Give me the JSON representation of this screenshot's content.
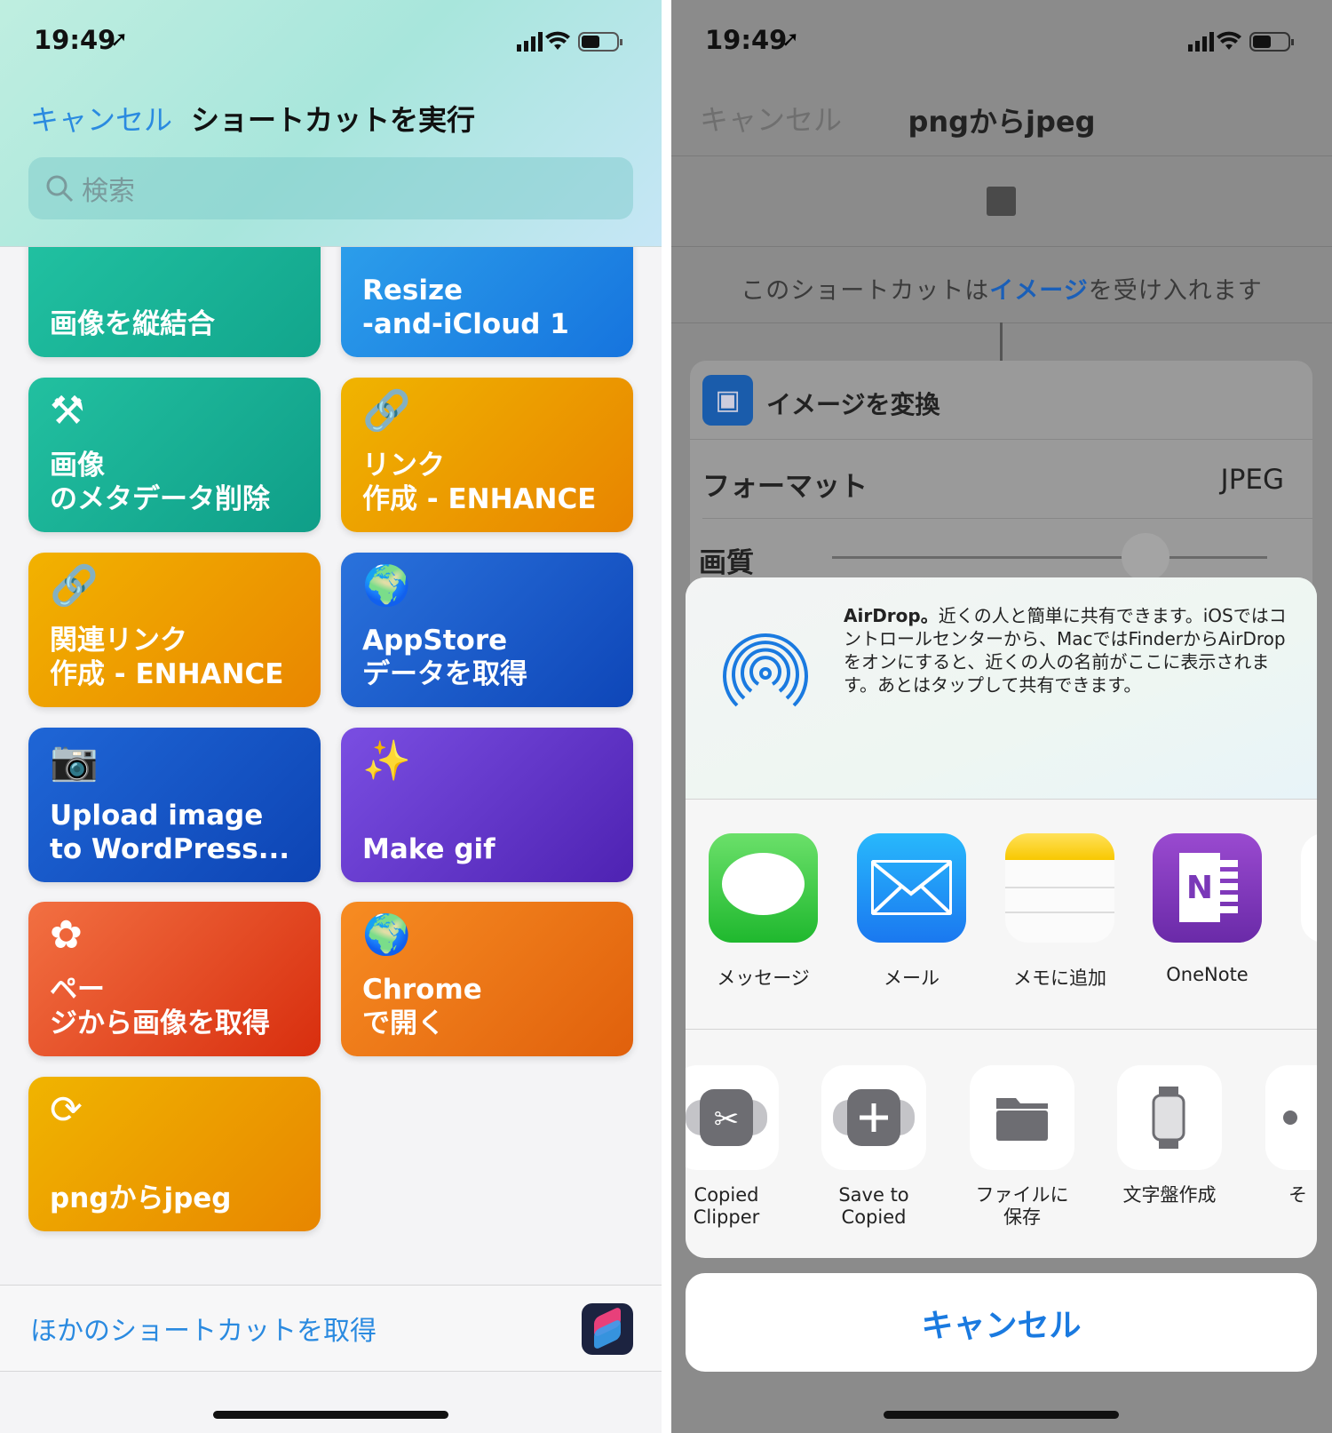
{
  "status": {
    "time": "19:49"
  },
  "left": {
    "nav": {
      "cancel": "キャンセル",
      "title": "ショートカットを実行"
    },
    "search": {
      "placeholder": "検索",
      "icon": "search-icon"
    },
    "tiles": [
      {
        "label": "画像を縦結合",
        "icon": "check-circle-icon",
        "glyph": "✓",
        "colors": [
          "#22c3a3",
          "#12a58c"
        ]
      },
      {
        "label": "Resize\n-and-iCloud 1",
        "icon": "window-icon",
        "glyph": "▭",
        "colors": [
          "#2ea2ec",
          "#1674de"
        ]
      },
      {
        "label": "画像\nのメタデータ削除",
        "icon": "hammer-icon",
        "glyph": "⚒",
        "colors": [
          "#22c0a0",
          "#0f9e88"
        ]
      },
      {
        "label": "リンク\n作成 - ENHANCE",
        "icon": "link-icon",
        "glyph": "🔗",
        "colors": [
          "#f0b400",
          "#e88400"
        ]
      },
      {
        "label": "関連リンク\n作成 - ENHANCE",
        "icon": "link-icon",
        "glyph": "🔗",
        "colors": [
          "#f2b200",
          "#e98600"
        ]
      },
      {
        "label": "AppStore\nデータを取得",
        "icon": "globe-icon",
        "glyph": "🌍",
        "colors": [
          "#2a72dc",
          "#0e46b8"
        ]
      },
      {
        "label": "Upload image\nto WordPress...",
        "icon": "camera-icon",
        "glyph": "📷",
        "colors": [
          "#1f66d6",
          "#0d44b4"
        ]
      },
      {
        "label": "Make gif",
        "icon": "magic-wand-icon",
        "glyph": "✨",
        "colors": [
          "#7a4ee2",
          "#4e22b2"
        ]
      },
      {
        "label": "ペー\nジから画像を取得",
        "icon": "flower-icon",
        "glyph": "✿",
        "colors": [
          "#f27042",
          "#d82e0e"
        ]
      },
      {
        "label": "Chrome\nで開く",
        "icon": "globe-icon",
        "glyph": "🌍",
        "colors": [
          "#f78c22",
          "#e0600c"
        ]
      },
      {
        "label": "pngからjpeg",
        "icon": "refresh-icon",
        "glyph": "⟳",
        "colors": [
          "#f0b400",
          "#e88600"
        ]
      }
    ],
    "footer": {
      "link": "ほかのショートカットを取得",
      "icon": "shortcuts-app-icon"
    }
  },
  "right": {
    "nav": {
      "cancel": "キャンセル",
      "title": "pngからjpeg"
    },
    "accepts": {
      "before": "このショートカットは",
      "highlight": "イメージ",
      "after": "を受け入れます"
    },
    "action": {
      "title": "イメージを変換",
      "format_label": "フォーマット",
      "format_value": "JPEG",
      "quality_label": "画質",
      "quality_value": 0.72
    },
    "airdrop": {
      "bold": "AirDrop。",
      "text": "近くの人と簡単に共有できます。iOSではコントロールセンターから、MacではFinderからAirDropをオンにすると、近くの人の名前がここに表示されます。あとはタップして共有できます。"
    },
    "apps": [
      {
        "label": "メッセージ",
        "icon": "messages-icon"
      },
      {
        "label": "メール",
        "icon": "mail-icon"
      },
      {
        "label": "メモに追加",
        "icon": "notes-icon"
      },
      {
        "label": "OneNote",
        "icon": "onenote-icon"
      }
    ],
    "actions": [
      {
        "label": "Copied\nClipper",
        "icon": "scissors-icon"
      },
      {
        "label": "Save to\nCopied",
        "icon": "plus-icon"
      },
      {
        "label": "ファイルに\n保存",
        "icon": "folder-icon"
      },
      {
        "label": "文字盤作成",
        "icon": "watch-icon"
      },
      {
        "label": "そ",
        "icon": "more-icon"
      }
    ],
    "cancel": "キャンセル"
  },
  "colors": {
    "accent": "#1a7ae0",
    "link": "#2a8ae0"
  }
}
